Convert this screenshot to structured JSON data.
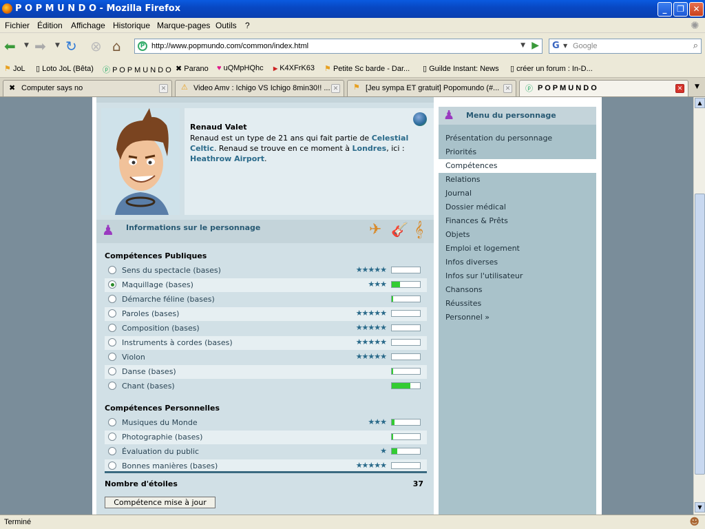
{
  "window": {
    "title": "P O P M U N D O - Mozilla Firefox"
  },
  "menu": [
    "Fichier",
    "Édition",
    "Affichage",
    "Historique",
    "Marque-pages",
    "Outils",
    "?"
  ],
  "nav": {
    "url": "http://www.popmundo.com/common/index.html",
    "search_placeholder": "Google"
  },
  "bookmarks": [
    "JoL",
    "Loto JoL (Bêta)",
    "P O P M U N D O",
    "Parano",
    "uQMpHQhc",
    "K4XFrK63",
    "Petite Sc barde - Dar...",
    "Guilde Instant: News",
    "créer un forum : In-D..."
  ],
  "tabs": [
    {
      "label": "Computer says no"
    },
    {
      "label": "Video Amv : Ichigo VS Ichigo 8min30!! ..."
    },
    {
      "label": "[Jeu sympa ET gratuit] Popomundo (#..."
    },
    {
      "label": "P O P M U N D O"
    }
  ],
  "status": "Terminé",
  "character": {
    "name": "Renaud Valet",
    "bio1": "Renaud est un type de 21 ans qui fait partie de ",
    "band": "Celestial Celtic",
    "bio2": ". Renaud se trouve en ce moment à ",
    "city": "Londres",
    "bio3": ", ici : ",
    "place": "Heathrow Airport",
    "bio4": "."
  },
  "info_title": "Informations sur le personnage",
  "right_menu": {
    "title": "Menu du personnage",
    "items": [
      "Présentation du personnage",
      "Priorités",
      "Compétences",
      "Relations",
      "Journal",
      "Dossier médical",
      "Finances & Prêts",
      "Objets",
      "Emploi et logement",
      "Infos diverses",
      "Infos sur l'utilisateur",
      "Chansons",
      "Réussites",
      "Personnel »"
    ],
    "active": "Compétences"
  },
  "public_title": "Compétences Publiques",
  "public_skills": [
    {
      "label": "Sens du spectacle (bases)",
      "stars": "★★★★★",
      "level": 0,
      "checked": false
    },
    {
      "label": "Maquillage (bases)",
      "stars": "★★★",
      "level": 0.3,
      "checked": true
    },
    {
      "label": "Démarche féline (bases)",
      "stars": "",
      "level": 0.05,
      "checked": false
    },
    {
      "label": "Paroles (bases)",
      "stars": "★★★★★",
      "level": 0,
      "checked": false
    },
    {
      "label": "Composition (bases)",
      "stars": "★★★★★",
      "level": 0,
      "checked": false
    },
    {
      "label": "Instruments à cordes (bases)",
      "stars": "★★★★★",
      "level": 0,
      "checked": false
    },
    {
      "label": "Violon",
      "stars": "★★★★★",
      "level": 0,
      "checked": false
    },
    {
      "label": "Danse (bases)",
      "stars": "",
      "level": 0.05,
      "checked": false
    },
    {
      "label": "Chant (bases)",
      "stars": "",
      "level": 0.65,
      "checked": false
    }
  ],
  "personal_title": "Compétences Personnelles",
  "personal_skills": [
    {
      "label": "Musiques du Monde",
      "stars": "★★★",
      "level": 0.1,
      "checked": false
    },
    {
      "label": "Photographie (bases)",
      "stars": "",
      "level": 0.05,
      "checked": false
    },
    {
      "label": "Évaluation du public",
      "stars": "★",
      "level": 0.2,
      "checked": false
    },
    {
      "label": "Bonnes manières (bases)",
      "stars": "★★★★★",
      "level": 0,
      "checked": false
    }
  ],
  "summary": {
    "label": "Nombre d'étoiles",
    "value": "37",
    "button": "Compétence mise à jour"
  }
}
